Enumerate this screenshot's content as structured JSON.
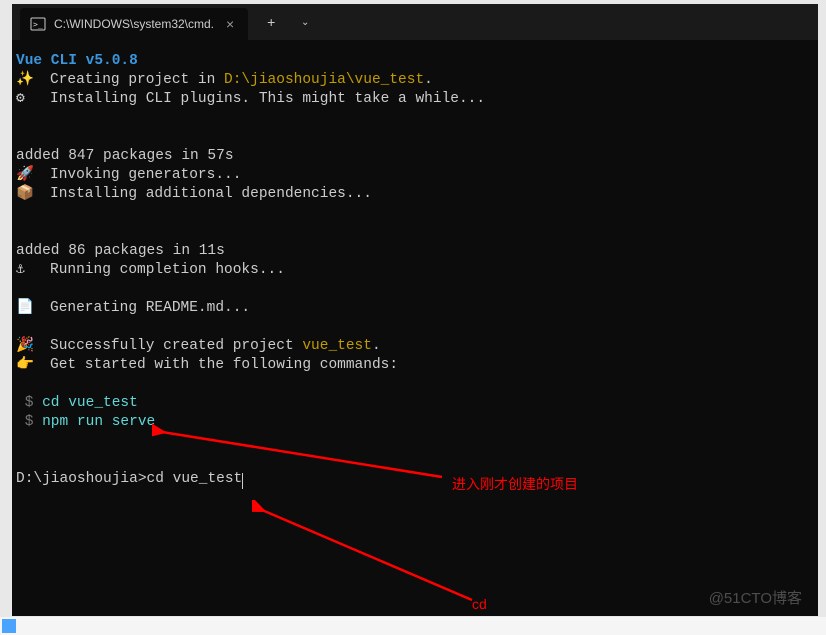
{
  "tab": {
    "title": "C:\\WINDOWS\\system32\\cmd."
  },
  "output": {
    "header": "Vue CLI v5.0.8",
    "creating_prefix": "Creating project in ",
    "creating_path": "D:\\jiaoshoujia\\vue_test",
    "installing_cli": "Installing CLI plugins. This might take a while...",
    "added1": "added 847 packages in 57s",
    "invoking": "Invoking generators...",
    "installing_deps": "Installing additional dependencies...",
    "added2": "added 86 packages in 11s",
    "running_hooks": "Running completion hooks...",
    "generating": "Generating README.md...",
    "success_prefix": "Successfully created project ",
    "success_name": "vue_test",
    "getstarted": "Get started with the following commands:",
    "cmd1_prefix": " $ ",
    "cmd1": "cd vue_test",
    "cmd2_prefix": " $ ",
    "cmd2": "npm run serve",
    "prompt": "D:\\jiaoshoujia>",
    "typed": "cd vue_test"
  },
  "annotations": {
    "note1": "进入刚才创建的项目",
    "note2": "cd"
  },
  "watermark": "@51CTO博客",
  "icons": {
    "sparkle": "✨",
    "gear": "⚙",
    "rocket": "🚀",
    "package": "📦",
    "anchor": "⚓",
    "page": "📄",
    "party": "🎉",
    "hand": "👉"
  }
}
